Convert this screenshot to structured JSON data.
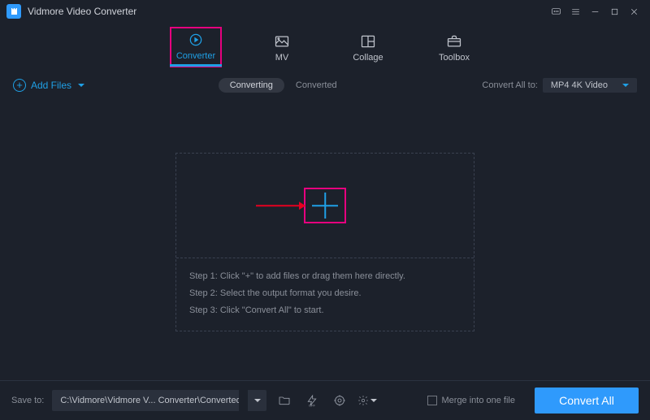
{
  "app_title": "Vidmore Video Converter",
  "tabs": {
    "converter": "Converter",
    "mv": "MV",
    "collage": "Collage",
    "toolbox": "Toolbox"
  },
  "subbar": {
    "add_files": "Add Files",
    "converting": "Converting",
    "converted": "Converted",
    "convert_all_to_label": "Convert All to:",
    "format_selected": "MP4 4K Video"
  },
  "dropzone": {
    "step1": "Step 1: Click \"+\" to add files or drag them here directly.",
    "step2": "Step 2: Select the output format you desire.",
    "step3": "Step 3: Click \"Convert All\" to start."
  },
  "bottom": {
    "save_to_label": "Save to:",
    "save_path": "C:\\Vidmore\\Vidmore V... Converter\\Converted",
    "merge_label": "Merge into one file",
    "convert_all": "Convert All"
  }
}
